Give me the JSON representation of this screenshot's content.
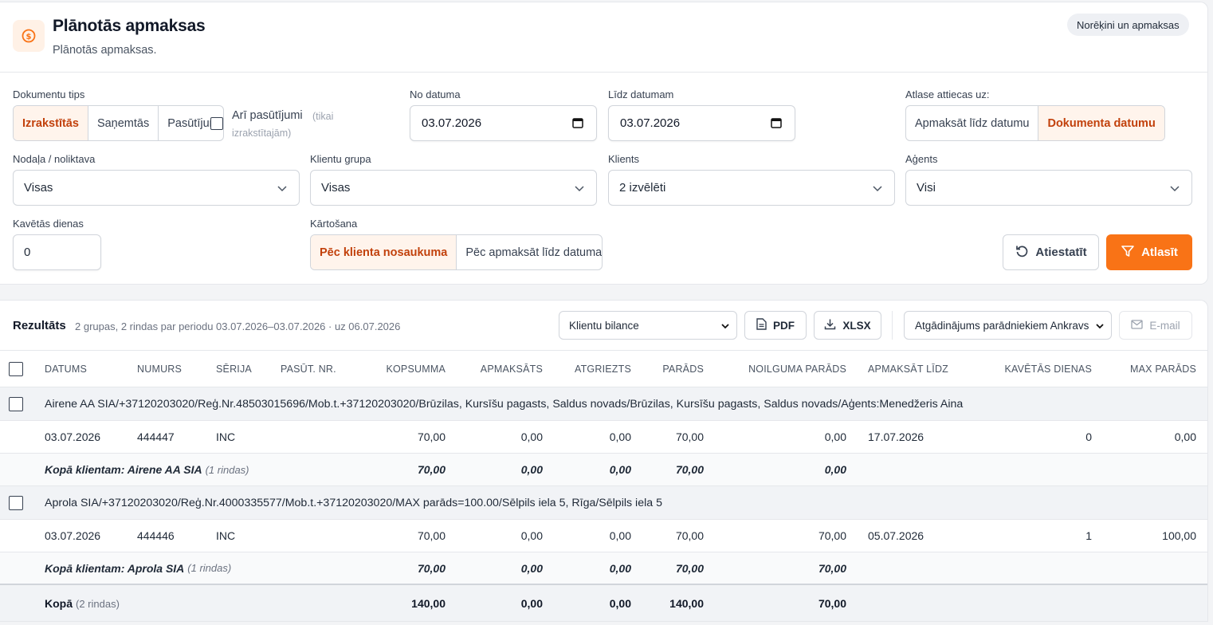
{
  "header": {
    "title": "Plānotās apmaksas",
    "subtitle": "Plānotās apmaksas.",
    "pill": "Norēķini un apmaksas"
  },
  "filters": {
    "doc_type_label": "Dokumentu tips",
    "doc_types": [
      "Izrakstītās",
      "Saņemtās",
      "Pasūtījum"
    ],
    "also_orders": "Arī pasūtījumi",
    "also_orders_hint1": "(tikai",
    "also_orders_hint2": "izrakstītajām)",
    "from_label": "No datuma",
    "from_value": "03.07.2026",
    "to_label": "Līdz datumam",
    "to_value": "03.07.2026",
    "applies_label": "Atlase attiecas uz:",
    "applies_options": [
      "Apmaksāt līdz datumu",
      "Dokumenta datumu"
    ],
    "dept_label": "Nodaļa / noliktava",
    "dept_value": "Visas",
    "group_label": "Klientu grupa",
    "group_value": "Visas",
    "client_label": "Klients",
    "client_value": "2 izvēlēti",
    "agent_label": "Aģents",
    "agent_value": "Visi",
    "overdue_label": "Kavētās dienas",
    "overdue_value": "0",
    "sort_label": "Kārtošana",
    "sort_options": [
      "Pēc klienta nosaukuma",
      "Pēc apmaksāt līdz datuma"
    ],
    "reset_label": "Atiestatīt",
    "filter_label": "Atlasīt"
  },
  "results": {
    "title": "Rezultāts",
    "meta": "2 grupas, 2 rindas par periodu 03.07.2026–03.07.2026 · uz 06.07.2026",
    "view_select": "Klientu bilance",
    "pdf_label": "PDF",
    "xlsx_label": "XLSX",
    "reminder_select": "Atgādinājums parādniekiem Ankravs",
    "email_label": "E-mail",
    "columns": [
      "Datums",
      "Numurs",
      "Sērija",
      "Pasūt. nr.",
      "Kopsumma",
      "Apmaksāts",
      "Atgriezts",
      "Parāds",
      "Noilguma parāds",
      "Apmaksāt līdz",
      "Kavētās dienas",
      "Max parāds"
    ],
    "groups": [
      {
        "header": "Airene AA SIA/+37120203020/Reģ.Nr.48503015696/Mob.t.+37120203020/Brūzilas, Kursīšu pagasts, Saldus novads/Brūzilas, Kursīšu pagasts, Saldus novads/Aģents:Menedžeris Aina",
        "row": [
          "03.07.2026",
          "444447",
          "INC",
          "",
          "70,00",
          "0,00",
          "0,00",
          "70,00",
          "0,00",
          "17.07.2026",
          "0",
          "0,00"
        ],
        "subtotal_label": "Kopā klientam: Airene AA SIA",
        "subtotal_count": "(1 rindas)",
        "subtotal": [
          "70,00",
          "0,00",
          "0,00",
          "70,00",
          "0,00"
        ]
      },
      {
        "header": "Aprola SIA/+37120203020/Reģ.Nr.4000335577/Mob.t.+37120203020/MAX parāds=100.00/Sēlpils iela 5, Rīga/Sēlpils iela 5",
        "row": [
          "03.07.2026",
          "444446",
          "INC",
          "",
          "70,00",
          "0,00",
          "0,00",
          "70,00",
          "70,00",
          "05.07.2026",
          "1",
          "100,00"
        ],
        "subtotal_label": "Kopā klientam: Aprola SIA",
        "subtotal_count": "(1 rindas)",
        "subtotal": [
          "70,00",
          "0,00",
          "0,00",
          "70,00",
          "70,00"
        ]
      }
    ],
    "total_label": "Kopā",
    "total_count": "(2 rindas)",
    "total": [
      "140,00",
      "0,00",
      "0,00",
      "140,00",
      "70,00"
    ]
  },
  "colors": {
    "accent": "#f97316",
    "accent_text": "#c2410c",
    "accent_bg": "#fff4ec"
  }
}
